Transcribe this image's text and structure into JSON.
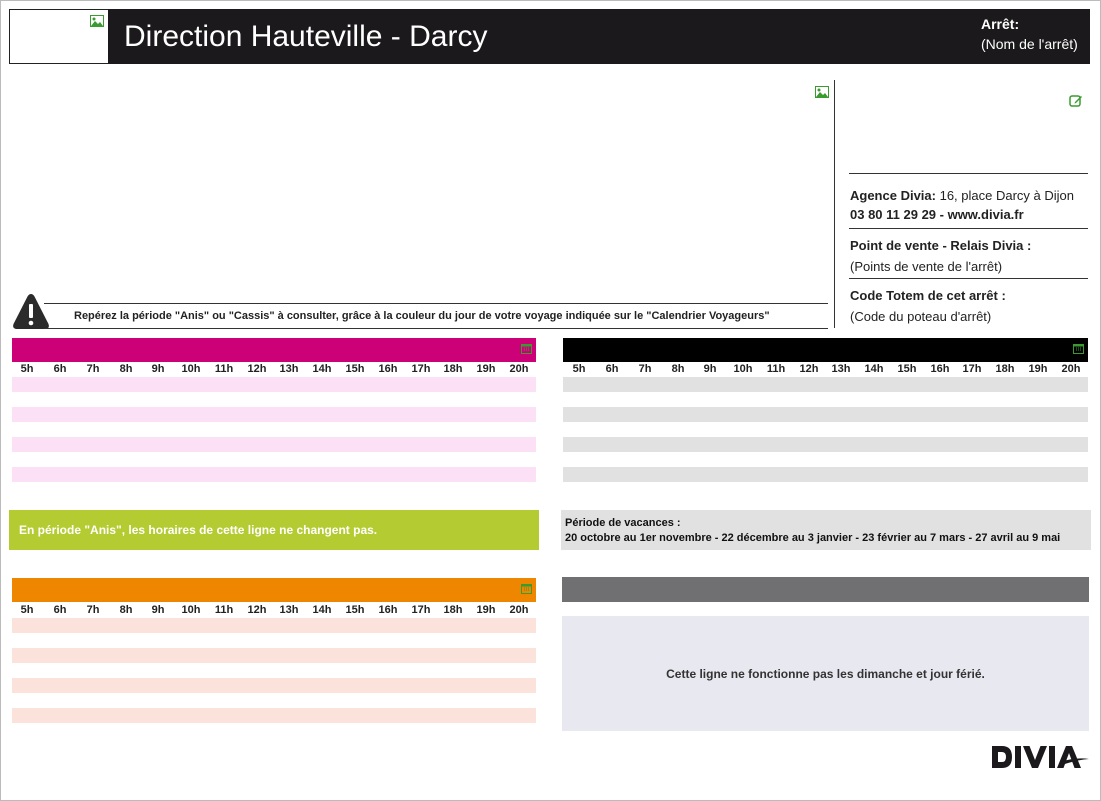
{
  "header": {
    "title": "Direction Hauteville - Darcy",
    "stop_label": "Arrêt:",
    "stop_name": "(Nom de l'arrêt)"
  },
  "info": {
    "agency_label": "Agence Divia:",
    "agency_address": " 16, place Darcy à Dijon",
    "agency_contact": "03 80 11 29 29 - www.divia.fr",
    "sale_label": "Point de vente - Relais Divia :",
    "sale_value": "(Points de vente de l'arrêt)",
    "totem_label": "Code Totem de cet arrêt :",
    "totem_value": "(Code du poteau d'arrêt)"
  },
  "warning": {
    "text": "Repérez la période \"Anis\" ou \"Cassis\" à consulter, grâce à la couleur du jour de votre voyage indiquée sur le \"Calendrier Voyageurs\""
  },
  "hours": [
    "5h",
    "6h",
    "7h",
    "8h",
    "9h",
    "10h",
    "11h",
    "12h",
    "13h",
    "14h",
    "15h",
    "16h",
    "17h",
    "18h",
    "19h",
    "20h"
  ],
  "tables": {
    "magenta": {
      "color": "#cc0077",
      "band_color": "#fbe0f6"
    },
    "black": {
      "color": "#000000",
      "band_color": "#e1e1e1"
    },
    "orange": {
      "color": "#ee8600",
      "band_color": "#fbe2da"
    }
  },
  "anis_note": "En période \"Anis\", les horaires de cette ligne ne changent pas.",
  "vacation": {
    "title": "Période de vacances :",
    "dates": "20 octobre au 1er novembre - 22 décembre au 3 janvier - 23 février au 7 mars - 27 avril au 9 mai"
  },
  "sunday_note": "Cette ligne ne fonctionne pas les dimanche et jour férié.",
  "icons": {
    "image": "image-icon",
    "edit": "edit-icon",
    "calendar": "calendar-icon",
    "warning": "warning-icon"
  },
  "brand": {
    "accent": "#3a9b2e"
  }
}
